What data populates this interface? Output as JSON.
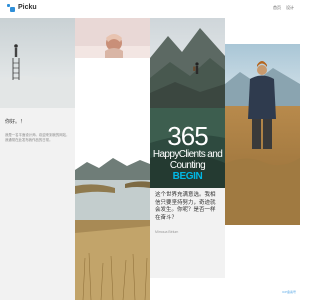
{
  "header": {
    "brand": "Picku",
    "nav": [
      {
        "label": "首页"
      },
      {
        "label": "设计"
      }
    ]
  },
  "intro": {
    "title": "你好。！",
    "text": "我是一名平面设计师。欢迎来到我的网站，我通常在此发布我作品的日常。"
  },
  "counter": {
    "number": "365",
    "line1": "HappyClients and",
    "line2": "Counting",
    "line3": "BEGIN"
  },
  "quote": {
    "text": "这个世界充满意选。我相信只要坚持努力，奇迹就会发生。你呢？是否一样在奋斗？",
    "author": "Mimoua Bélum"
  },
  "footer": {
    "link": "ICP备案号"
  },
  "colors": {
    "brand_blue": "#2f8fd8",
    "accent_cyan": "#00b8e6",
    "panel_gray": "#f2f2f2"
  }
}
